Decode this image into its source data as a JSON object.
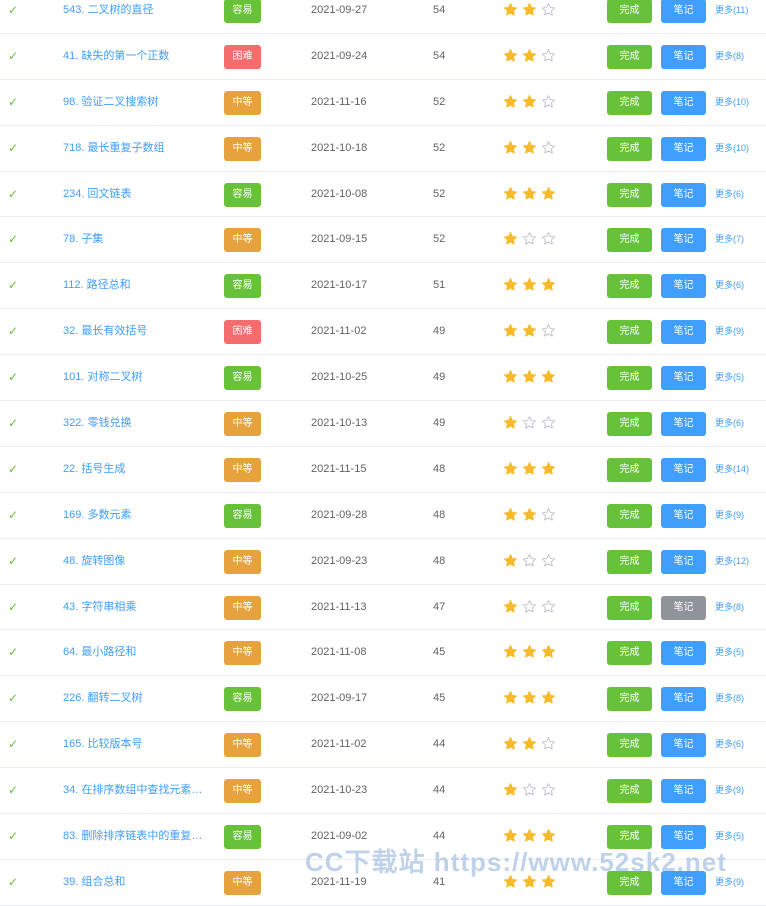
{
  "colors": {
    "easy": "#67c23a",
    "medium": "#e6a23c",
    "hard": "#f56c6c",
    "done_button": "#67c23a",
    "note_button": "#409eff",
    "note_button_inactive": "#909399",
    "star_filled": "#f7ba2a",
    "star_empty": "#c0c4cc"
  },
  "difficulty_labels": {
    "easy": "容易",
    "medium": "中等",
    "hard": "困难"
  },
  "rows": [
    {
      "title": "543. 二叉树的直径",
      "difficulty": "easy",
      "difficulty_label": "容易",
      "date": "2021-09-27",
      "count": "54",
      "stars": 2,
      "done_label": "完成",
      "note_label": "笔记",
      "note_active": true,
      "more_label": "更多(11)"
    },
    {
      "title": "41. 缺失的第一个正数",
      "difficulty": "hard",
      "difficulty_label": "困难",
      "date": "2021-09-24",
      "count": "54",
      "stars": 2,
      "done_label": "完成",
      "note_label": "笔记",
      "note_active": true,
      "more_label": "更多(8)"
    },
    {
      "title": "98. 验证二叉搜索树",
      "difficulty": "medium",
      "difficulty_label": "中等",
      "date": "2021-11-16",
      "count": "52",
      "stars": 2,
      "done_label": "完成",
      "note_label": "笔记",
      "note_active": true,
      "more_label": "更多(10)"
    },
    {
      "title": "718. 最长重复子数组",
      "difficulty": "medium",
      "difficulty_label": "中等",
      "date": "2021-10-18",
      "count": "52",
      "stars": 2,
      "done_label": "完成",
      "note_label": "笔记",
      "note_active": true,
      "more_label": "更多(10)"
    },
    {
      "title": "234. 回文链表",
      "difficulty": "easy",
      "difficulty_label": "容易",
      "date": "2021-10-08",
      "count": "52",
      "stars": 3,
      "done_label": "完成",
      "note_label": "笔记",
      "note_active": true,
      "more_label": "更多(6)"
    },
    {
      "title": "78. 子集",
      "difficulty": "medium",
      "difficulty_label": "中等",
      "date": "2021-09-15",
      "count": "52",
      "stars": 1,
      "done_label": "完成",
      "note_label": "笔记",
      "note_active": true,
      "more_label": "更多(7)"
    },
    {
      "title": "112. 路径总和",
      "difficulty": "easy",
      "difficulty_label": "容易",
      "date": "2021-10-17",
      "count": "51",
      "stars": 3,
      "done_label": "完成",
      "note_label": "笔记",
      "note_active": true,
      "more_label": "更多(6)"
    },
    {
      "title": "32. 最长有效括号",
      "difficulty": "hard",
      "difficulty_label": "困难",
      "date": "2021-11-02",
      "count": "49",
      "stars": 2,
      "done_label": "完成",
      "note_label": "笔记",
      "note_active": true,
      "more_label": "更多(9)"
    },
    {
      "title": "101. 对称二叉树",
      "difficulty": "easy",
      "difficulty_label": "容易",
      "date": "2021-10-25",
      "count": "49",
      "stars": 3,
      "done_label": "完成",
      "note_label": "笔记",
      "note_active": true,
      "more_label": "更多(5)"
    },
    {
      "title": "322. 零钱兑换",
      "difficulty": "medium",
      "difficulty_label": "中等",
      "date": "2021-10-13",
      "count": "49",
      "stars": 1,
      "done_label": "完成",
      "note_label": "笔记",
      "note_active": true,
      "more_label": "更多(6)"
    },
    {
      "title": "22. 括号生成",
      "difficulty": "medium",
      "difficulty_label": "中等",
      "date": "2021-11-15",
      "count": "48",
      "stars": 3,
      "done_label": "完成",
      "note_label": "笔记",
      "note_active": true,
      "more_label": "更多(14)"
    },
    {
      "title": "169. 多数元素",
      "difficulty": "easy",
      "difficulty_label": "容易",
      "date": "2021-09-28",
      "count": "48",
      "stars": 2,
      "done_label": "完成",
      "note_label": "笔记",
      "note_active": true,
      "more_label": "更多(9)"
    },
    {
      "title": "48. 旋转图像",
      "difficulty": "medium",
      "difficulty_label": "中等",
      "date": "2021-09-23",
      "count": "48",
      "stars": 1,
      "done_label": "完成",
      "note_label": "笔记",
      "note_active": true,
      "more_label": "更多(12)"
    },
    {
      "title": "43. 字符串相乘",
      "difficulty": "medium",
      "difficulty_label": "中等",
      "date": "2021-11-13",
      "count": "47",
      "stars": 1,
      "done_label": "完成",
      "note_label": "笔记",
      "note_active": false,
      "more_label": "更多(8)"
    },
    {
      "title": "64. 最小路径和",
      "difficulty": "medium",
      "difficulty_label": "中等",
      "date": "2021-11-08",
      "count": "45",
      "stars": 3,
      "done_label": "完成",
      "note_label": "笔记",
      "note_active": true,
      "more_label": "更多(5)"
    },
    {
      "title": "226. 翻转二叉树",
      "difficulty": "easy",
      "difficulty_label": "容易",
      "date": "2021-09-17",
      "count": "45",
      "stars": 3,
      "done_label": "完成",
      "note_label": "笔记",
      "note_active": true,
      "more_label": "更多(8)"
    },
    {
      "title": "165. 比较版本号",
      "difficulty": "medium",
      "difficulty_label": "中等",
      "date": "2021-11-02",
      "count": "44",
      "stars": 2,
      "done_label": "完成",
      "note_label": "笔记",
      "note_active": true,
      "more_label": "更多(6)"
    },
    {
      "title": "34. 在排序数组中查找元素…",
      "difficulty": "medium",
      "difficulty_label": "中等",
      "date": "2021-10-23",
      "count": "44",
      "stars": 1,
      "done_label": "完成",
      "note_label": "笔记",
      "note_active": true,
      "more_label": "更多(9)"
    },
    {
      "title": "83. 删除排序链表中的重复…",
      "difficulty": "easy",
      "difficulty_label": "容易",
      "date": "2021-09-02",
      "count": "44",
      "stars": 3,
      "done_label": "完成",
      "note_label": "笔记",
      "note_active": true,
      "more_label": "更多(5)"
    },
    {
      "title": "39. 组合总和",
      "difficulty": "medium",
      "difficulty_label": "中等",
      "date": "2021-11-19",
      "count": "41",
      "stars": 3,
      "done_label": "完成",
      "note_label": "笔记",
      "note_active": true,
      "more_label": "更多(9)"
    }
  ],
  "watermark": "CC下载站 https://www.52sk2.net",
  "icons": {
    "status": "check-icon",
    "rating_filled": "star-filled-icon",
    "rating_empty": "star-empty-icon"
  }
}
